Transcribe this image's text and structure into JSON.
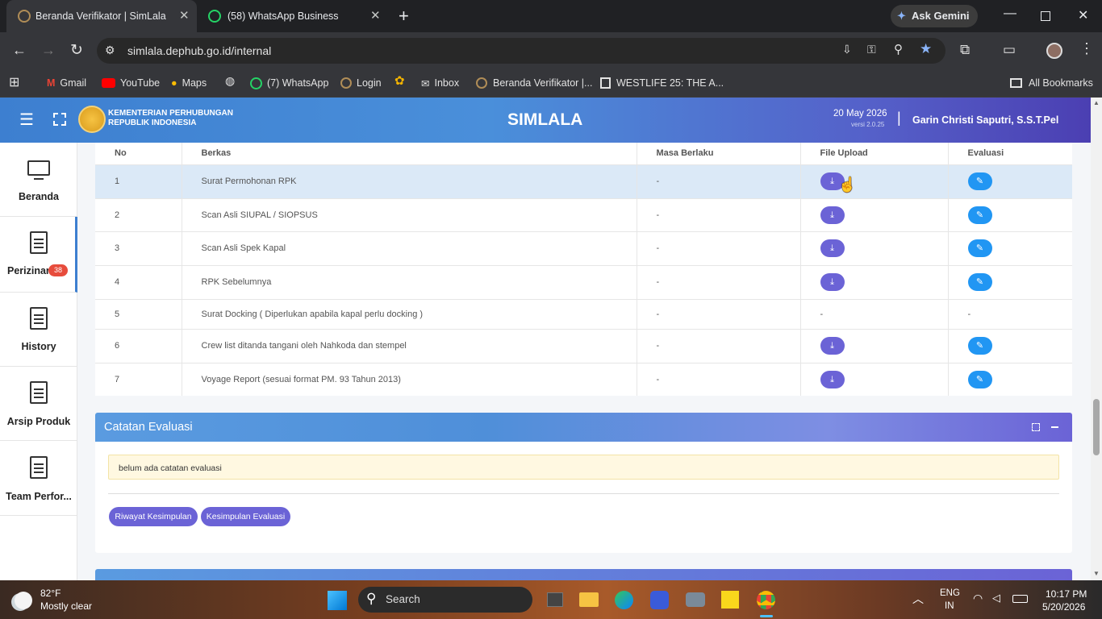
{
  "browser": {
    "tabs": [
      {
        "title": "Beranda Verifikator | SimLala",
        "active": true
      },
      {
        "title": "(58) WhatsApp Business",
        "active": false
      }
    ],
    "new_tab": "+",
    "ask_gemini": "Ask Gemini",
    "url": "simlala.dephub.go.id/internal",
    "bookmarks": [
      "Gmail",
      "YouTube",
      "Maps",
      "(7) WhatsApp",
      "Login",
      "Inbox",
      "Beranda Verifikator |...",
      "WESTLIFE 25: THE A..."
    ],
    "all_bookmarks": "All Bookmarks"
  },
  "header": {
    "org_line1": "KEMENTERIAN PERHUBUNGAN",
    "org_line2": "REPUBLIK INDONESIA",
    "app_title": "SIMLALA",
    "date": "20 May 2026",
    "version": "versi 2.0.25",
    "divider": "|",
    "user": "Garin Christi Saputri, S.S.T.Pel"
  },
  "sidebar": {
    "items": [
      {
        "label": "Beranda"
      },
      {
        "label": "Perizinan",
        "badge": "38"
      },
      {
        "label": "History"
      },
      {
        "label": "Arsip Produk"
      },
      {
        "label": "Team Perfor..."
      }
    ]
  },
  "table": {
    "headers": [
      "No",
      "Berkas",
      "Masa Berlaku",
      "File Upload",
      "Evaluasi"
    ],
    "rows": [
      {
        "no": "1",
        "berkas": "Surat Permohonan RPK",
        "masa": "-",
        "upload": "btn",
        "eval": "btn"
      },
      {
        "no": "2",
        "berkas": "Scan Asli SIUPAL / SIOPSUS",
        "masa": "-",
        "upload": "btn",
        "eval": "btn"
      },
      {
        "no": "3",
        "berkas": "Scan Asli Spek Kapal",
        "masa": "-",
        "upload": "btn",
        "eval": "btn"
      },
      {
        "no": "4",
        "berkas": "RPK Sebelumnya",
        "masa": "-",
        "upload": "btn",
        "eval": "btn"
      },
      {
        "no": "5",
        "berkas": "Surat Docking ( Diperlukan apabila kapal perlu docking )",
        "masa": "-",
        "upload": "-",
        "eval": "-"
      },
      {
        "no": "6",
        "berkas": "Crew list ditanda tangani oleh Nahkoda dan stempel",
        "masa": "-",
        "upload": "btn",
        "eval": "btn"
      },
      {
        "no": "7",
        "berkas": "Voyage Report (sesuai format PM. 93 Tahun 2013)",
        "masa": "-",
        "upload": "btn",
        "eval": "btn"
      }
    ]
  },
  "evaluasi": {
    "title": "Catatan Evaluasi",
    "note": "belum ada catatan evaluasi",
    "btn_riwayat": "Riwayat Kesimpulan",
    "btn_kesimpulan": "Kesimpulan Evaluasi"
  },
  "taskbar": {
    "temp": "82°F",
    "weather": "Mostly clear",
    "search": "Search",
    "lang1": "ENG",
    "lang2": "IN",
    "time": "10:17 PM",
    "date": "5/20/2026"
  },
  "colors": {
    "header_start": "#3d7fd0",
    "header_end": "#4b3fb2",
    "download_btn": "#6b63d6",
    "eval_btn": "#2196f3",
    "badge": "#e74c3c",
    "note_bg": "#fff8e1"
  }
}
